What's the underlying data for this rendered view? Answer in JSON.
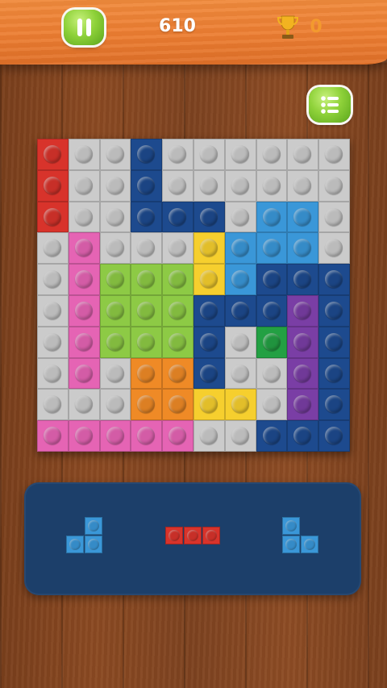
{
  "header": {
    "score": "610",
    "best": "0"
  },
  "colors": {
    "r": "#d8332b",
    "w": "#cbcbcb",
    "d": "#1d4a8e",
    "l": "#3a97d8",
    "y": "#f6cf2e",
    "p": "#e564b4",
    "g": "#8dca45",
    "o": "#ef8a26",
    "v": "#7a3ea5",
    "e": "#23a043"
  },
  "board": [
    "rwwdwwwwww",
    "rwwdwwwwww",
    "rwwdddwllw",
    "wpwwwylllw",
    "wpgggylddd",
    "wpgggdddvd",
    "wpgggdwevd",
    "wpwoodwwvd",
    "wwwooyywvd",
    "pppppwwddd"
  ],
  "tray": {
    "pieces": [
      {
        "name": "piece-left-l",
        "color": "l",
        "cells": [
          [
            1,
            0
          ],
          [
            0,
            1
          ],
          [
            1,
            1
          ]
        ]
      },
      {
        "name": "piece-center-line",
        "color": "r",
        "cells": [
          [
            0,
            0
          ],
          [
            1,
            0
          ],
          [
            2,
            0
          ]
        ]
      },
      {
        "name": "piece-right-l",
        "color": "l",
        "cells": [
          [
            0,
            0
          ],
          [
            0,
            1
          ],
          [
            1,
            1
          ]
        ]
      }
    ]
  }
}
